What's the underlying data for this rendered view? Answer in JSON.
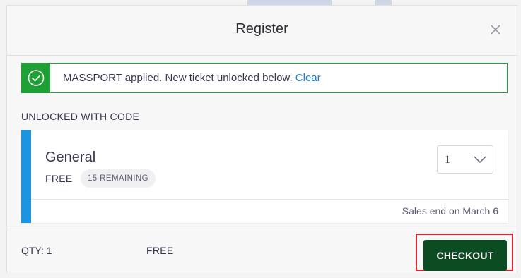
{
  "modal": {
    "title": "Register",
    "close_icon": "close-icon"
  },
  "alert": {
    "icon": "check-circle-icon",
    "message": "MASSPORT applied. New ticket unlocked below.",
    "link_label": "Clear",
    "color": "#1ea035"
  },
  "section": {
    "label": "UNLOCKED WITH CODE"
  },
  "ticket": {
    "name": "General",
    "price": "FREE",
    "remaining": "15 REMAINING",
    "quantity": "1",
    "chevron_icon": "chevron-down-icon",
    "sales_end": "Sales end on March 6",
    "accent_color": "#1d94e0"
  },
  "footer": {
    "qty_label": "QTY: 1",
    "total": "FREE",
    "checkout_label": "CHECKOUT",
    "checkout_color": "#0c4c23",
    "highlight_color": "#e0242f"
  }
}
